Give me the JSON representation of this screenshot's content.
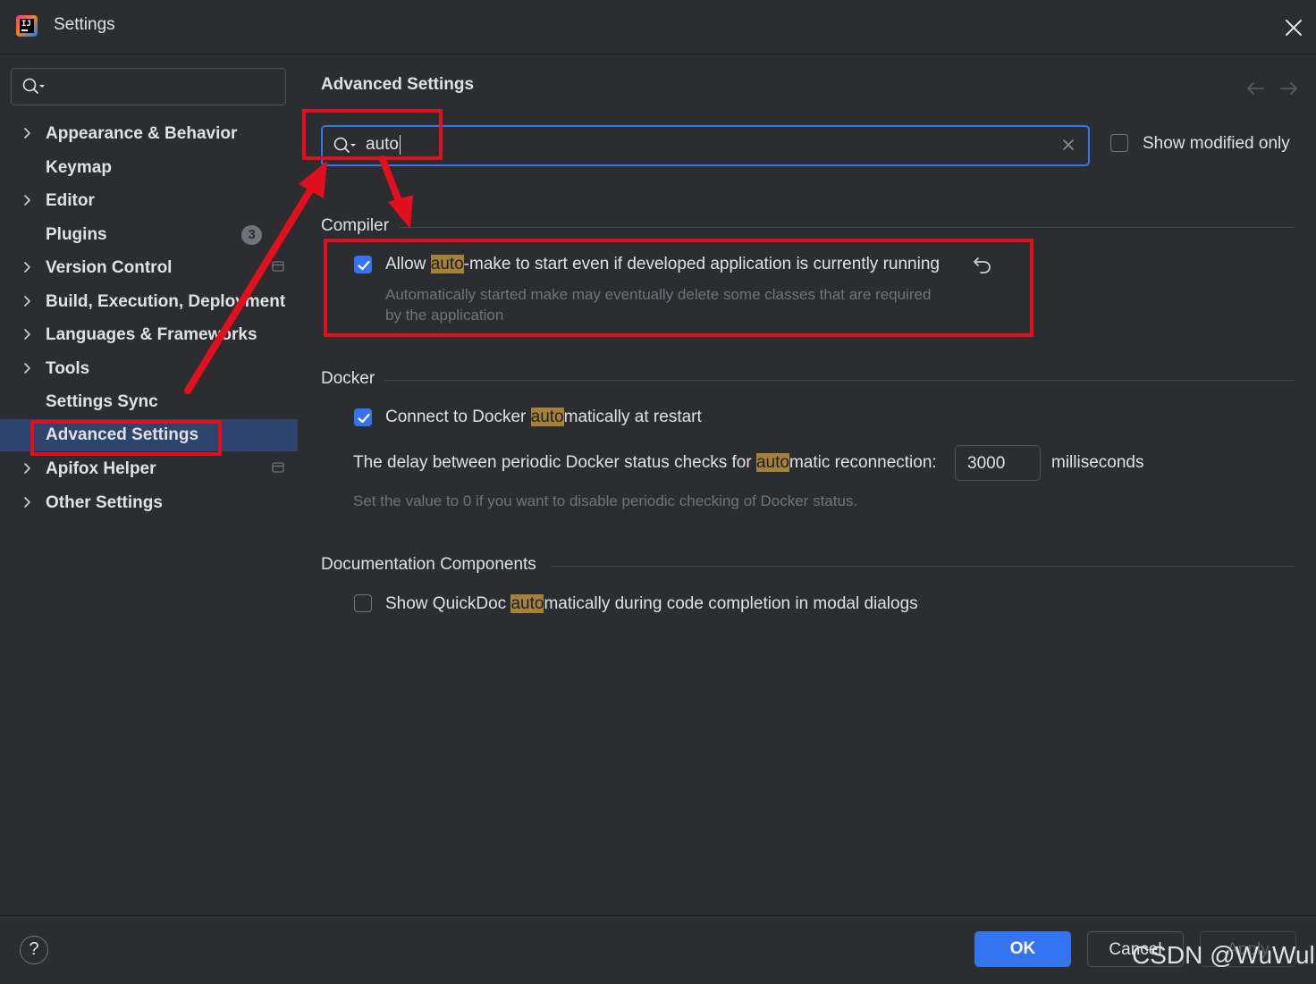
{
  "window": {
    "title": "Settings"
  },
  "sidebar": {
    "search": {
      "placeholder": ""
    },
    "items": [
      {
        "label": "Appearance & Behavior",
        "expandable": true
      },
      {
        "label": "Keymap",
        "expandable": false
      },
      {
        "label": "Editor",
        "expandable": true
      },
      {
        "label": "Plugins",
        "expandable": false,
        "badge": "3"
      },
      {
        "label": "Version Control",
        "expandable": true,
        "project_icon": true
      },
      {
        "label": "Build, Execution, Deployment",
        "expandable": true
      },
      {
        "label": "Languages & Frameworks",
        "expandable": true
      },
      {
        "label": "Tools",
        "expandable": true
      },
      {
        "label": "Settings Sync",
        "expandable": false
      },
      {
        "label": "Advanced Settings",
        "expandable": false,
        "selected": true
      },
      {
        "label": "Apifox Helper",
        "expandable": true,
        "project_icon": true
      },
      {
        "label": "Other Settings",
        "expandable": true
      }
    ]
  },
  "panel": {
    "title": "Advanced Settings",
    "filter": {
      "value": "auto"
    },
    "show_modified_only": {
      "label": "Show modified only",
      "checked": false
    },
    "sections": {
      "compiler": {
        "title": "Compiler",
        "option": {
          "checked": true,
          "label_pre": "Allow ",
          "label_hl": "auto",
          "label_post": "-make to start even if developed application is currently running",
          "description_line1": "Automatically started make may eventually delete some classes that are required",
          "description_line2": "by the application"
        }
      },
      "docker": {
        "title": "Docker",
        "connect": {
          "checked": true,
          "label_pre": "Connect to Docker ",
          "label_hl": "auto",
          "label_post": "matically at restart"
        },
        "delay": {
          "label_pre": "The delay between periodic Docker status checks for ",
          "label_hl": "auto",
          "label_post": "matic reconnection:",
          "value": "3000",
          "unit": "milliseconds",
          "description": "Set the value to 0 if you want to disable periodic checking of Docker status."
        }
      },
      "documentation": {
        "title": "Documentation Components",
        "quickdoc": {
          "checked": false,
          "label_pre": "Show QuickDoc ",
          "label_hl": "auto",
          "label_post": "matically during code completion in modal dialogs"
        }
      }
    }
  },
  "footer": {
    "help": "?",
    "ok": "OK",
    "cancel": "Cancel",
    "apply": "Apply"
  },
  "watermark": "CSDN @WuWull",
  "colors": {
    "background": "#2b2d30",
    "accent": "#3574f0",
    "selection": "#2e436e",
    "highlight": "#a5813a",
    "annotation": "#e0101c"
  }
}
